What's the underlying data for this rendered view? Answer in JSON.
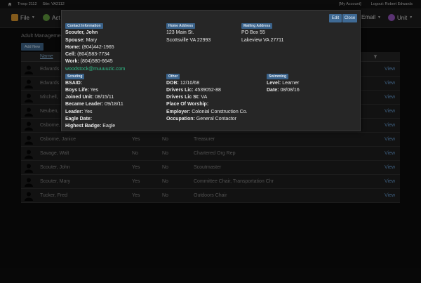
{
  "topbar": {
    "troop": "Troop 2112",
    "site": "Site: VA2112",
    "account": "[My Account]",
    "logout": "Logout: Robert Edwards"
  },
  "navbar": {
    "file_label": "File",
    "act_label": "Act",
    "email_label": "Email",
    "unit_label": "Unit"
  },
  "page": {
    "title": "Adult Management",
    "add_button": "Add New",
    "name_header": "Name",
    "view_label": "View",
    "rows": [
      {
        "name": "Edwards",
        "c2": "",
        "c3": "",
        "c4": ""
      },
      {
        "name": "Edwards",
        "c2": "",
        "c3": "",
        "c4": ""
      },
      {
        "name": "Mitchell,",
        "c2": "",
        "c3": "",
        "c4": ""
      },
      {
        "name": "Neuben,",
        "c2": "",
        "c3": "",
        "c4": ""
      },
      {
        "name": "Osborne,",
        "c2": "",
        "c3": "",
        "c4": ""
      },
      {
        "name": "Osborne, Janice",
        "c2": "Yes",
        "c3": "No",
        "c4": "Treasurer"
      },
      {
        "name": "Savage, Walt",
        "c2": "No",
        "c3": "No",
        "c4": "Chartered Org Rep"
      },
      {
        "name": "Scouter, John",
        "c2": "Yes",
        "c3": "No",
        "c4": "Scoutmaster"
      },
      {
        "name": "Scouter, Mary",
        "c2": "Yes",
        "c3": "No",
        "c4": "Committee Chair, Transportation Chr"
      },
      {
        "name": "Tucker, Fred",
        "c2": "Yes",
        "c3": "No",
        "c4": "Outdoors Chair"
      }
    ]
  },
  "modal": {
    "edit_button": "Edit",
    "close_button": "Close",
    "contact": {
      "label": "Contact Information",
      "name": "Scouter, John",
      "spouse_k": "Spouse:",
      "spouse_v": "Mary",
      "home_k": "Home:",
      "home_v": "(804)442-1965",
      "cell_k": "Cell:",
      "cell_v": "(804)583-7734",
      "work_k": "Work:",
      "work_v": "(804)580-6645",
      "email": "woodstock@muuuuzic.com"
    },
    "home_address": {
      "label": "Home Address",
      "line1": "123 Main St.",
      "line2": "Scottsville  VA  22993"
    },
    "mailing_address": {
      "label": "Mailing Address",
      "line1": "PO Box 55",
      "line2": "Lakeview  VA  27711"
    },
    "scouting": {
      "label": "Scouting",
      "bsaid_k": "BSAID:",
      "bsaid_v": "",
      "boyslife_k": "Boys Life:",
      "boyslife_v": "Yes",
      "joined_k": "Joined Unit:",
      "joined_v": "08/15/11",
      "became_k": "Became Leader:",
      "became_v": "09/18/11",
      "leader_k": "Leader:",
      "leader_v": "Yes",
      "eagle_k": "Eagle Date:",
      "eagle_v": "",
      "badge_k": "Highest Badge:",
      "badge_v": "Eagle"
    },
    "other": {
      "label": "Other",
      "dob_k": "DOB:",
      "dob_v": "12/10/68",
      "lic_k": "Drivers Lic:",
      "lic_v": "4539052-88",
      "licst_k": "Drivers Lic St:",
      "licst_v": "VA",
      "worship_k": "Place Of Worship:",
      "worship_v": "",
      "employer_k": "Employer:",
      "employer_v": "Colonial Construction Co.",
      "occ_k": "Occupation:",
      "occ_v": "General Contactor"
    },
    "swimming": {
      "label": "Swimming",
      "level_k": "Level:",
      "level_v": "Learner",
      "date_k": "Date:",
      "date_v": "08/08/16"
    }
  }
}
